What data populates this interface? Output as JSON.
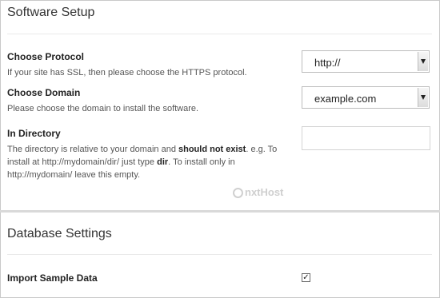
{
  "software_setup": {
    "title": "Software Setup",
    "protocol": {
      "label": "Choose Protocol",
      "description": "If your site has SSL, then please choose the HTTPS protocol.",
      "value": "http://"
    },
    "domain": {
      "label": "Choose Domain",
      "description": "Please choose the domain to install the software.",
      "value": "example.com"
    },
    "directory": {
      "label": "In Directory",
      "desc_part1": "The directory is relative to your domain and ",
      "desc_bold1": "should not exist",
      "desc_part2": ". e.g. To install at http://mydomain/dir/ just type ",
      "desc_bold2": "dir",
      "desc_part3": ". To install only in http://mydomain/ leave this empty.",
      "value": ""
    },
    "logo_text": "nxtHost"
  },
  "database_settings": {
    "title": "Database Settings",
    "import_sample": {
      "label": "Import Sample Data",
      "checked": true,
      "check_glyph": "✓"
    }
  },
  "icons": {
    "select_arrow": "chevron-down-icon",
    "checkbox": "checkmark-icon",
    "logo": "nxthost-logo-icon"
  },
  "colors": {
    "border": "#c9c9c9",
    "section_divider": "#d9d9d9",
    "text": "#333333"
  }
}
